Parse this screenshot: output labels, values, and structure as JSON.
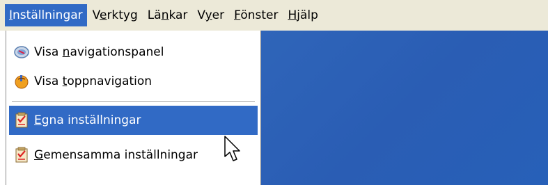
{
  "menubar": {
    "items": [
      {
        "label_pre": "",
        "label_u": "I",
        "label_post": "nställningar",
        "active": true
      },
      {
        "label_pre": "V",
        "label_u": "e",
        "label_post": "rktyg",
        "active": false
      },
      {
        "label_pre": "Lä",
        "label_u": "n",
        "label_post": "kar",
        "active": false
      },
      {
        "label_pre": "V",
        "label_u": "y",
        "label_post": "er",
        "active": false
      },
      {
        "label_pre": "",
        "label_u": "F",
        "label_post": "önster",
        "active": false
      },
      {
        "label_pre": "",
        "label_u": "H",
        "label_post": "jälp",
        "active": false
      }
    ]
  },
  "dropdown": {
    "items": [
      {
        "label_pre": "Visa ",
        "label_u": "n",
        "label_post": "avigationspanel",
        "icon": "navigation-panel-icon",
        "highlight": false
      },
      {
        "label_pre": "Visa ",
        "label_u": "t",
        "label_post": "oppnavigation",
        "icon": "top-navigation-icon",
        "highlight": false
      },
      {
        "label_pre": "",
        "label_u": "E",
        "label_post": "gna inställningar",
        "icon": "checklist-icon",
        "highlight": true
      },
      {
        "label_pre": "",
        "label_u": "G",
        "label_post": "emensamma inställningar",
        "icon": "checklist-icon",
        "highlight": false
      }
    ]
  },
  "colors": {
    "menubar_bg": "#ece9d8",
    "highlight": "#316ac5",
    "desktop": "#2a5db4"
  }
}
